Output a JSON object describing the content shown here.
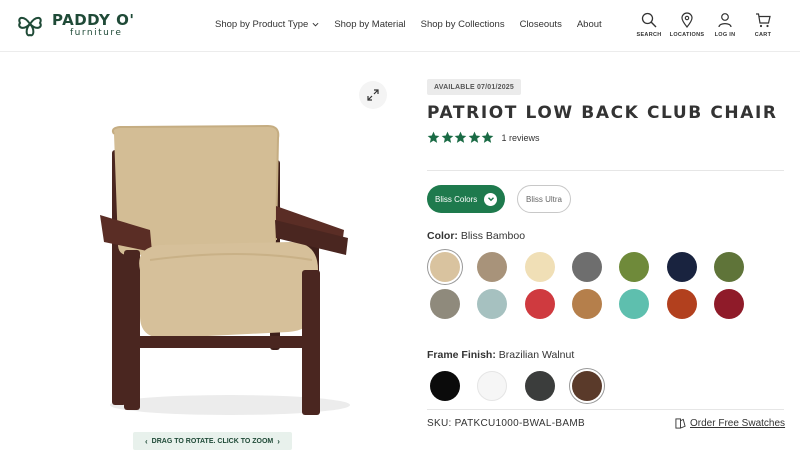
{
  "brand": {
    "name": "PADDY O'",
    "sub": "furniture"
  },
  "nav": [
    {
      "label": "Shop by Product Type",
      "has_dropdown": true
    },
    {
      "label": "Shop by Material"
    },
    {
      "label": "Shop by Collections"
    },
    {
      "label": "Closeouts"
    },
    {
      "label": "About"
    }
  ],
  "utility": [
    {
      "label": "SEARCH",
      "icon": "search-icon"
    },
    {
      "label": "LOCATIONS",
      "icon": "location-pin-icon"
    },
    {
      "label": "LOG IN",
      "icon": "user-icon"
    },
    {
      "label": "CART",
      "icon": "cart-icon"
    }
  ],
  "gallery": {
    "rotate_hint": "DRAG TO ROTATE. CLICK TO ZOOM"
  },
  "product": {
    "availability": "AVAILABLE 07/01/2025",
    "title": "PATRIOT LOW BACK CLUB CHAIR",
    "rating": 5,
    "reviews": "1 reviews",
    "sku_label": "SKU:",
    "sku": "PATKCU1000-BWAL-BAMB",
    "order_swatches": "Order Free Swatches"
  },
  "color_tabs": {
    "active": "Bliss Colors",
    "inactive": "Bliss Ultra"
  },
  "color": {
    "label": "Color:",
    "selected": "Bliss Bamboo",
    "swatches": [
      "#d9c39f",
      "#a8937a",
      "#f0dfb6",
      "#6e6e6e",
      "#6f8a3a",
      "#19233f",
      "#5f7439",
      "#8f8a7c",
      "#a6c1c0",
      "#cf3a3f",
      "#b57f4b",
      "#5ebfae",
      "#b2401e",
      "#8f1b29"
    ]
  },
  "frame": {
    "label": "Frame Finish:",
    "selected": "Brazilian Walnut",
    "swatches": [
      "#0b0b0b",
      "#f6f6f6",
      "#3b3d3c",
      "#5a3a2a"
    ]
  },
  "colors": {
    "brand_green": "#1e7a4d",
    "star_green": "#1a6b45"
  }
}
